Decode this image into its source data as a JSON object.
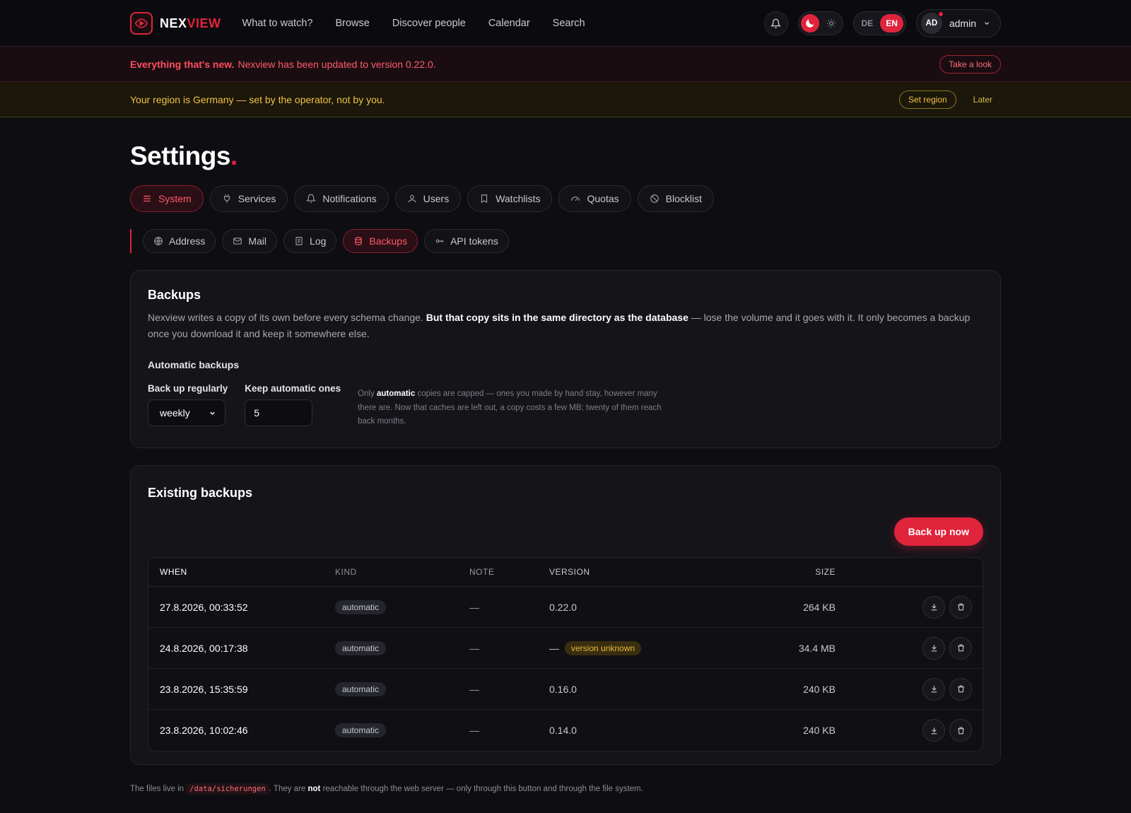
{
  "brand": {
    "first": "NEX",
    "second": "VIEW"
  },
  "nav": [
    "What to watch?",
    "Browse",
    "Discover people",
    "Calendar",
    "Search"
  ],
  "languages": {
    "de": "DE",
    "en": "EN"
  },
  "user": {
    "initials": "AD",
    "name": "admin"
  },
  "banner_news": {
    "strong": "Everything that's new.",
    "text": "Nexview has been updated to version 0.22.0.",
    "button": "Take a look"
  },
  "banner_region": {
    "text": "Your region is Germany — set by the operator, not by you.",
    "button": "Set region",
    "later": "Later"
  },
  "page": {
    "title": "Settings",
    "title_dot": "."
  },
  "tabs": [
    {
      "label": "System",
      "icon": "menu-icon"
    },
    {
      "label": "Services",
      "icon": "plug-icon"
    },
    {
      "label": "Notifications",
      "icon": "bell-icon"
    },
    {
      "label": "Users",
      "icon": "user-icon"
    },
    {
      "label": "Watchlists",
      "icon": "bookmark-icon"
    },
    {
      "label": "Quotas",
      "icon": "gauge-icon"
    },
    {
      "label": "Blocklist",
      "icon": "ban-icon"
    }
  ],
  "subtabs": [
    {
      "label": "Address",
      "icon": "globe-icon"
    },
    {
      "label": "Mail",
      "icon": "mail-icon"
    },
    {
      "label": "Log",
      "icon": "file-icon"
    },
    {
      "label": "Backups",
      "icon": "database-icon"
    },
    {
      "label": "API tokens",
      "icon": "key-icon"
    }
  ],
  "backups": {
    "title": "Backups",
    "desc_before": "Nexview writes a copy of its own before every schema change. ",
    "desc_bold": "But that copy sits in the same directory as the database",
    "desc_after": " — lose the volume and it goes with it. It only becomes a backup once you download it and keep it somewhere else.",
    "auto_heading": "Automatic backups",
    "regular_label": "Back up regularly",
    "regular_value": "weekly",
    "keep_label": "Keep automatic ones",
    "keep_value": "5",
    "hint_before": "Only ",
    "hint_bold": "automatic",
    "hint_after": " copies are capped — ones you made by hand stay, however many there are. Now that caches are left out, a copy costs a few MB; twenty of them reach back months."
  },
  "existing": {
    "title": "Existing backups",
    "button": "Back up now",
    "headers": {
      "when": "WHEN",
      "kind": "KIND",
      "note": "NOTE",
      "version": "VERSION",
      "size": "SIZE"
    },
    "rows": [
      {
        "when": "27.8.2026, 00:33:52",
        "kind": "automatic",
        "note": "—",
        "version": "0.22.0",
        "badge": "",
        "size": "264 KB"
      },
      {
        "when": "24.8.2026, 00:17:38",
        "kind": "automatic",
        "note": "—",
        "version": "—",
        "badge": "version unknown",
        "size": "34.4 MB"
      },
      {
        "when": "23.8.2026, 15:35:59",
        "kind": "automatic",
        "note": "—",
        "version": "0.16.0",
        "badge": "",
        "size": "240 KB"
      },
      {
        "when": "23.8.2026, 10:02:46",
        "kind": "automatic",
        "note": "—",
        "version": "0.14.0",
        "badge": "",
        "size": "240 KB"
      }
    ]
  },
  "footer": {
    "before": "The files live in ",
    "path": "/data/sicherungen",
    "middle": ". They are ",
    "bold": "not",
    "after": " reachable through the web server — only through this button and through the file system."
  },
  "colors": {
    "accent": "#e0243c",
    "warning": "#f1c243",
    "background": "#0e0e12"
  }
}
